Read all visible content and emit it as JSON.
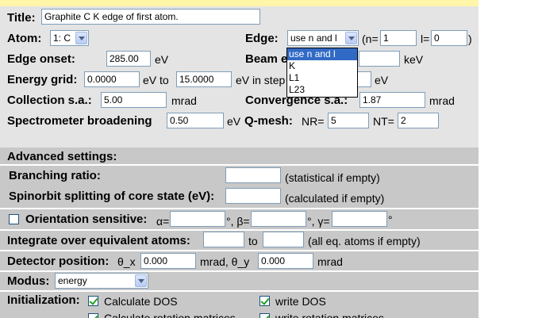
{
  "title": {
    "label": "Title:",
    "value": "Graphite C K edge of first atom."
  },
  "atom": {
    "label": "Atom:",
    "selected": "1: C"
  },
  "edge": {
    "label": "Edge:",
    "selected": "use n and l",
    "n_prefix": "(n=",
    "n_value": "1",
    "l_prefix": "l=",
    "l_value": "0",
    "suffix": ")",
    "options": [
      "use n and l",
      "K",
      "L1",
      "L23"
    ]
  },
  "edge_onset": {
    "label": "Edge onset:",
    "value": "285.00",
    "unit": "eV"
  },
  "beam_energy": {
    "label": "Beam e",
    "value": "",
    "unit": "keV"
  },
  "energy_grid": {
    "label": "Energy grid:",
    "from": "0.0000",
    "unit_to": "eV to",
    "to": "15.0000",
    "in_step": "eV in step",
    "step_value": "",
    "step_unit": "eV"
  },
  "collection": {
    "label": "Collection s.a.:",
    "value": "5.00",
    "unit": "mrad"
  },
  "convergence": {
    "label": "Convergence s.a.:",
    "value": "1.87",
    "unit": "mrad"
  },
  "spectrometer": {
    "label": "Spectrometer broadening",
    "value": "0.50",
    "unit": "eV"
  },
  "qmesh": {
    "label": "Q-mesh:",
    "nr_label": "NR=",
    "nr_value": "5",
    "nt_label": "NT=",
    "nt_value": "2"
  },
  "advanced": {
    "heading": "Advanced settings:"
  },
  "branching": {
    "label": "Branching ratio:",
    "value": "",
    "note": "(statistical if empty)"
  },
  "spinorbit": {
    "label": "Spinorbit splitting of core state (eV):",
    "value": "",
    "note": "(calculated if empty)"
  },
  "orientation": {
    "label": "Orientation sensitive:",
    "checked": false,
    "alpha": "α=",
    "beta": "°, β=",
    "gamma": "°, γ=",
    "deg": "°"
  },
  "integrate": {
    "label": "Integrate over equivalent atoms:",
    "to": "to",
    "note": "(all eq. atoms if empty)"
  },
  "detector": {
    "label": "Detector position:",
    "theta_x": "θ_x",
    "x_value": "0.000",
    "mid": "mrad, θ_y",
    "y_value": "0.000",
    "unit": "mrad"
  },
  "modus": {
    "label": "Modus:",
    "selected": "energy"
  },
  "init": {
    "label": "Initialization:",
    "calc_dos": "Calculate DOS",
    "write_dos": "write DOS",
    "calc_rot": "Calculate rotation matrices",
    "write_rot": "write rotation matrices"
  },
  "colors": {
    "panel": "#e4e4e4",
    "advanced": "#c8c8c8",
    "topbar": "#fff6a8",
    "highlight": "#316ac5"
  }
}
